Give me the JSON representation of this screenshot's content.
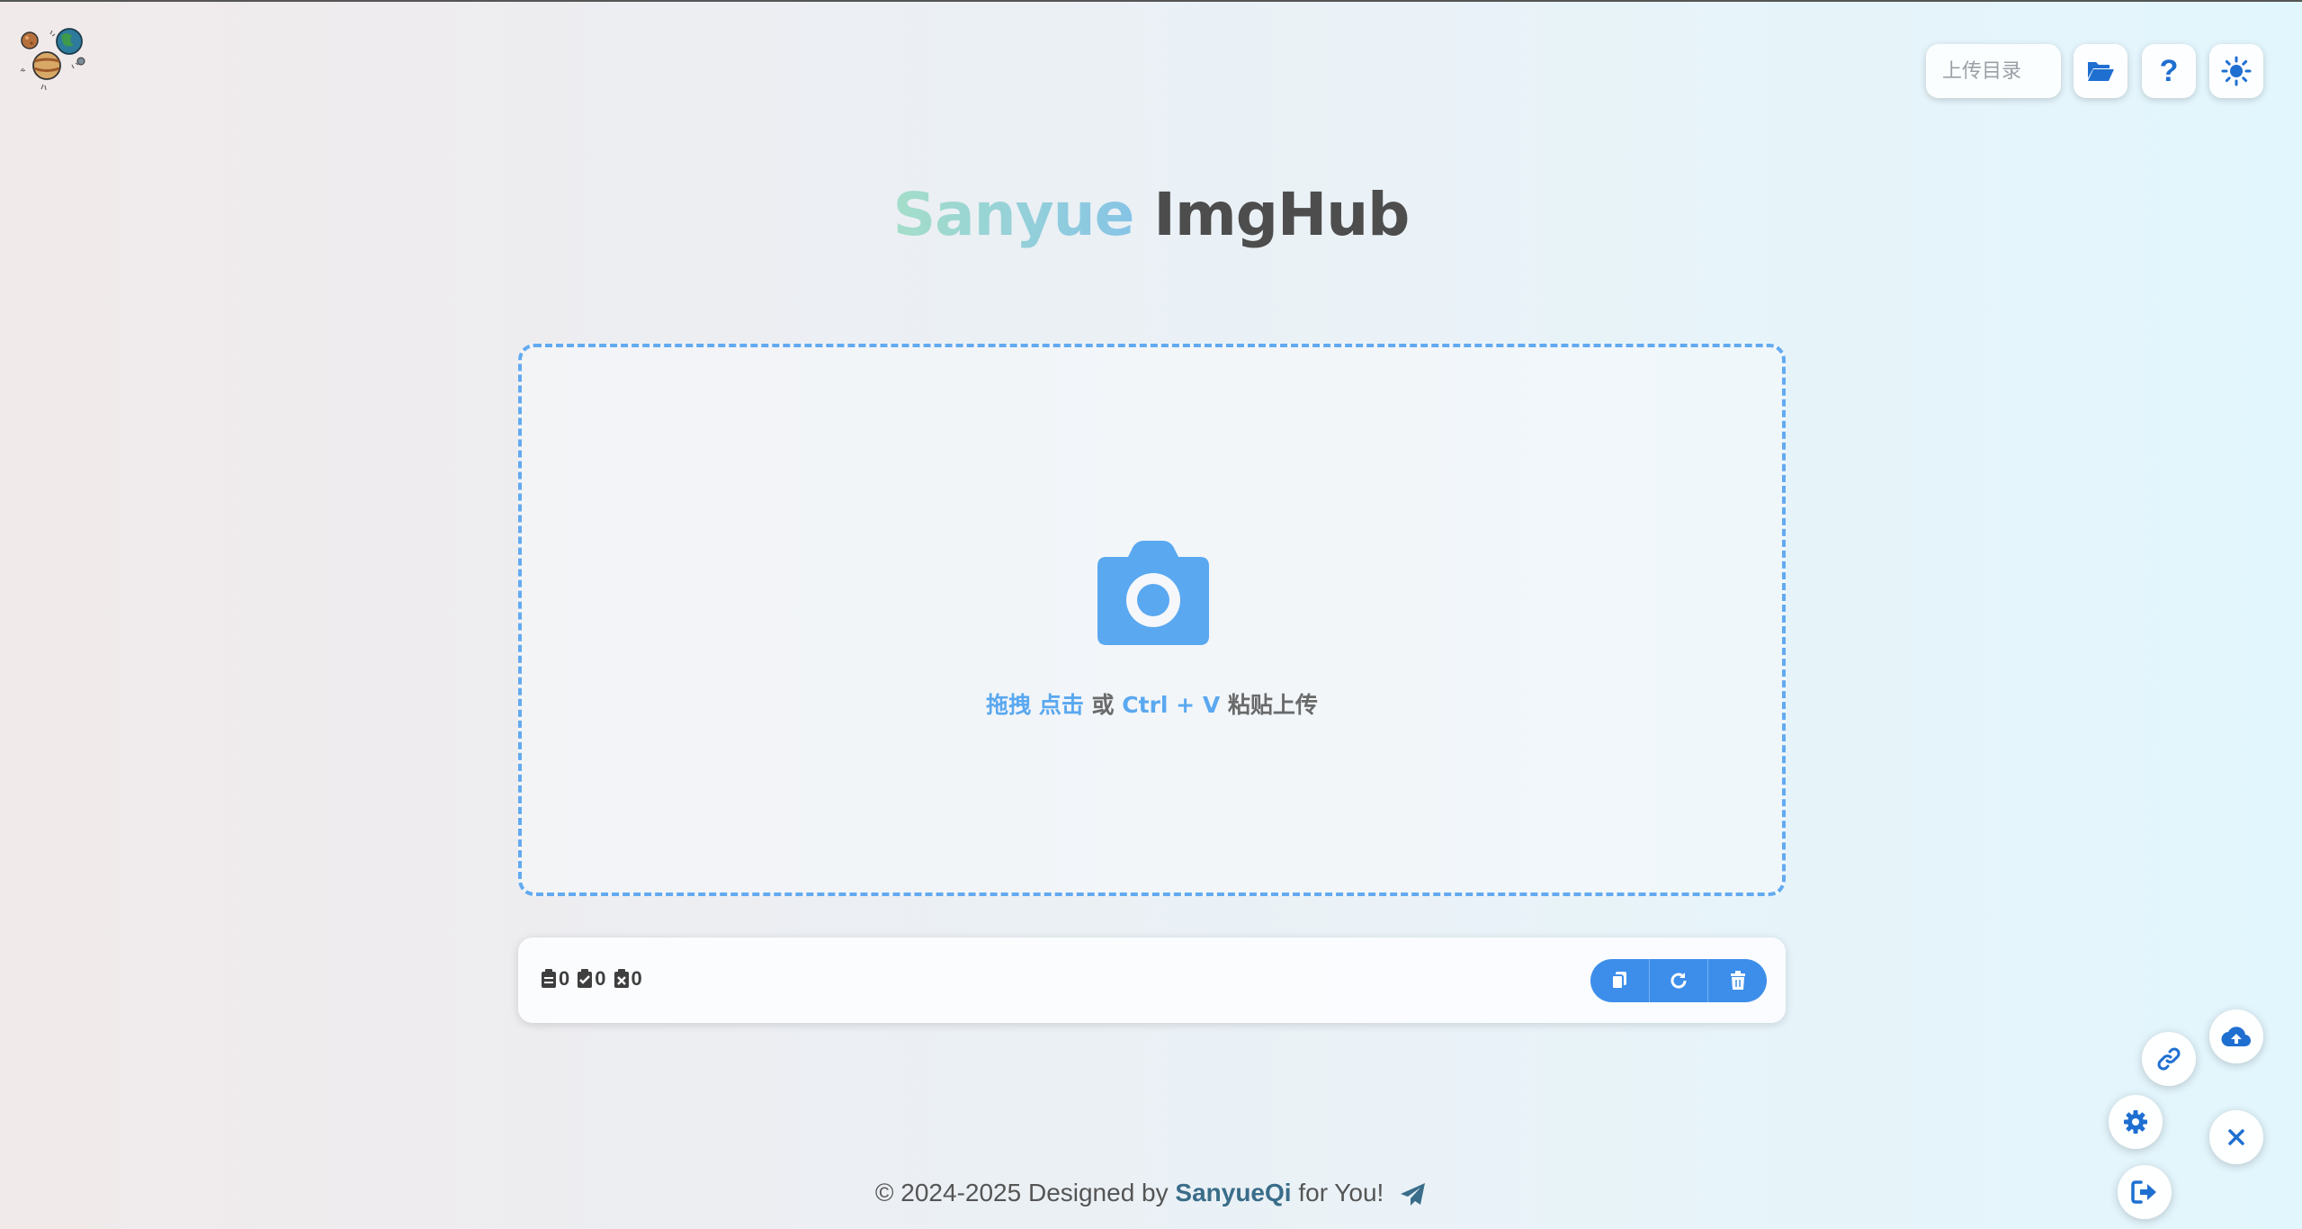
{
  "header": {
    "upload_dir_placeholder": "上传目录",
    "icons": {
      "logo": "planets-logo",
      "folder": "folder-open-icon",
      "help": "question-icon",
      "theme": "sun-icon"
    },
    "help_glyph": "?"
  },
  "title": {
    "part1": "Sanyue",
    "part2": "ImgHub"
  },
  "dropzone": {
    "drag": "拖拽",
    "click": "点击",
    "or": "或",
    "shortcut": "Ctrl + V",
    "paste_upload": "粘贴上传",
    "icon": "camera-icon"
  },
  "status": {
    "total": "0",
    "success": "0",
    "failed": "0",
    "icons": [
      "list-icon",
      "check-square-icon",
      "x-square-icon"
    ],
    "actions": [
      "copy-icon",
      "refresh-icon",
      "trash-icon"
    ]
  },
  "fabs": [
    "link-icon",
    "cloud-upload-icon",
    "gear-icon",
    "close-icon",
    "logout-icon"
  ],
  "footer": {
    "prefix": "© 2024-2025 Designed by",
    "author": "SanyueQi",
    "suffix": "for You!",
    "icon": "paper-plane-icon"
  },
  "colors": {
    "accent": "#3d8eea",
    "dashed_border": "#63aaf0",
    "link_blue": "#5aa8f0",
    "icon_blue": "#1f6fd1"
  }
}
